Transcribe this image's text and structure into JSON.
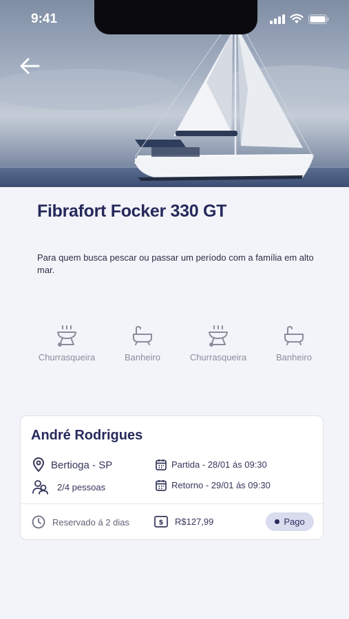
{
  "status_bar": {
    "time": "9:41"
  },
  "boat": {
    "name": "Fibrafort Focker 330 GT",
    "description": "Para quem busca pescar ou passar um período com a família em alto mar."
  },
  "amenities": [
    {
      "label": "Churrasqueira",
      "icon": "grill-icon"
    },
    {
      "label": "Banheiro",
      "icon": "bathtub-icon"
    },
    {
      "label": "Churrasqueira",
      "icon": "grill-icon"
    },
    {
      "label": "Banheiro",
      "icon": "bathtub-icon"
    }
  ],
  "booking": {
    "owner_name": "André Rodrigues",
    "location": "Bertioga - SP",
    "people": "2/4 pessoas",
    "departure": "Partida - 28/01 ás 09:30",
    "return": "Retorno - 29/01 ás 09:30",
    "reserved": "Reservado á 2 dias",
    "price": "R$127,99",
    "status": "Pago"
  },
  "colors": {
    "primary": "#26295b",
    "badge_bg": "#d9dbee",
    "background": "#f3f4f9"
  }
}
